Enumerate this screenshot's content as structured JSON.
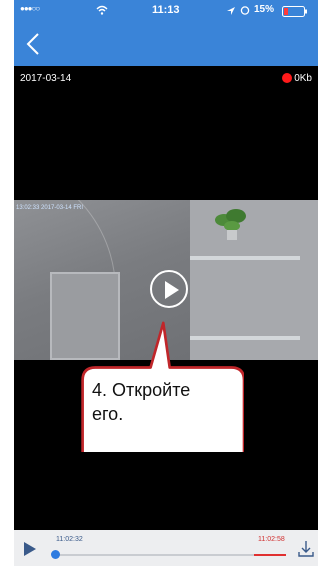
{
  "status_bar": {
    "carrier_dots": "●●●○○",
    "wifi": "wifi-icon",
    "time": "11:13",
    "battery": "15%"
  },
  "nav": {
    "back_icon": "chevron-left-icon"
  },
  "video": {
    "date": "2017-03-14",
    "data_rate": "0Kb",
    "overlay_text": "13:02:33 2017-03-14 FRI"
  },
  "callout": {
    "line1": "4. Откройте",
    "line2": "его."
  },
  "playback": {
    "start_time": "11:02:32",
    "end_time": "11:02:58"
  },
  "colors": {
    "nav": "#3a84d8",
    "record": "#ff1a1a",
    "accent": "#2e7be0",
    "callout_border": "#c0262a"
  }
}
